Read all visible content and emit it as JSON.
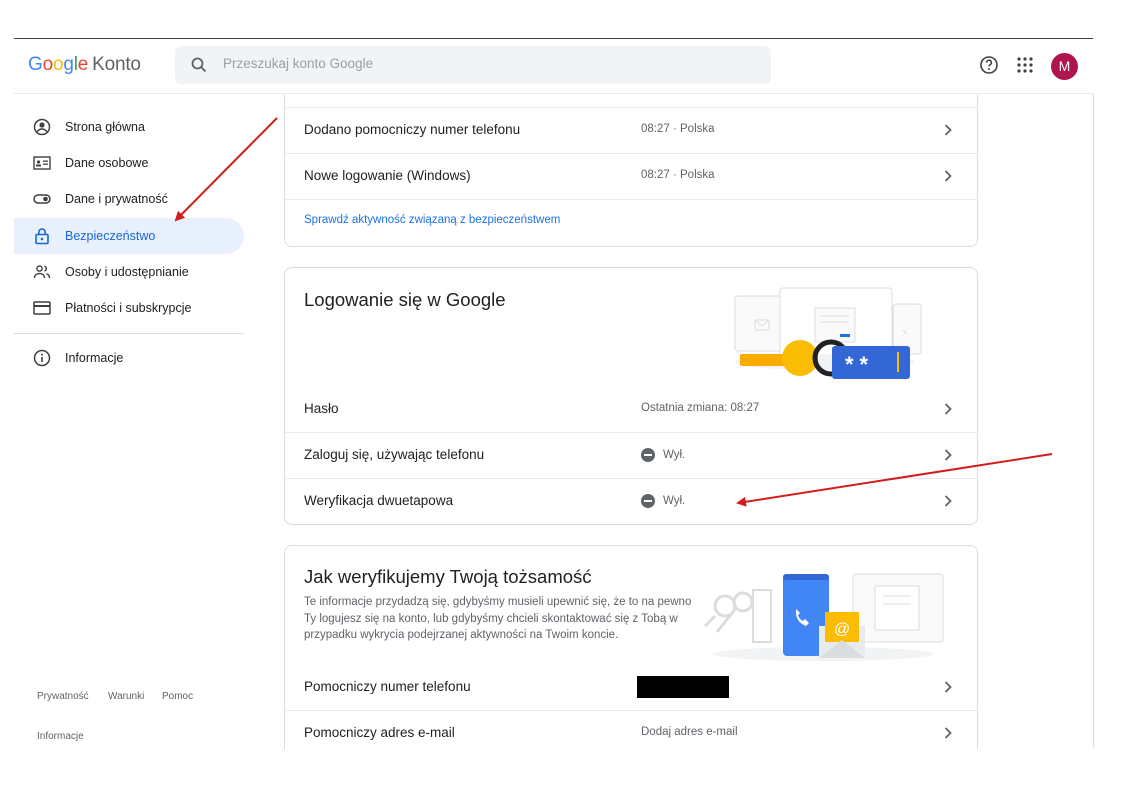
{
  "header": {
    "logo": {
      "g1": "G",
      "g2": "o",
      "g3": "o",
      "g4": "g",
      "g5": "l",
      "g6": "e",
      "product": "Konto"
    },
    "search_placeholder": "Przeszukaj konto Google",
    "avatar_letter": "M"
  },
  "sidebar": {
    "items": [
      {
        "label": "Strona główna",
        "icon": "account-circle-icon"
      },
      {
        "label": "Dane osobowe",
        "icon": "id-card-icon"
      },
      {
        "label": "Dane i prywatność",
        "icon": "toggle-icon"
      },
      {
        "label": "Bezpieczeństwo",
        "icon": "lock-icon",
        "active": true
      },
      {
        "label": "Osoby i udostępnianie",
        "icon": "people-icon"
      },
      {
        "label": "Płatności i subskrypcje",
        "icon": "credit-card-icon"
      },
      {
        "label": "Informacje",
        "icon": "info-icon"
      }
    ],
    "footer": {
      "privacy": "Prywatność",
      "terms": "Warunki",
      "help": "Pomoc",
      "about": "Informacje"
    }
  },
  "recent_activity": {
    "rows": [
      {
        "label": "Dodano pomocniczy numer telefonu",
        "value": "08:27 · Polska"
      },
      {
        "label": "Nowe logowanie (Windows)",
        "value": "08:27 · Polska"
      }
    ],
    "link": "Sprawdź aktywność związaną z bezpieczeństwem"
  },
  "signin": {
    "title": "Logowanie się w Google",
    "password_mask": "**",
    "rows": [
      {
        "label": "Hasło",
        "value": "Ostatnia zmiana: 08:27"
      },
      {
        "label": "Zaloguj się, używając telefonu",
        "value": "Wył."
      },
      {
        "label": "Weryfikacja dwuetapowa",
        "value": "Wył."
      }
    ]
  },
  "verify": {
    "title": "Jak weryfikujemy Twoją tożsamość",
    "desc": "Te informacje przydadzą się, gdybyśmy musieli upewnić się, że to na pewno Ty logujesz się na konto, lub gdybyśmy chcieli skontaktować się z Tobą w przypadku wykrycia podejrzanej aktywności na Twoim koncie.",
    "rows": [
      {
        "label": "Pomocniczy numer telefonu",
        "value": ""
      },
      {
        "label": "Pomocniczy adres e-mail",
        "value": "Dodaj adres e-mail"
      }
    ]
  },
  "colors": {
    "accent": "#1a73e8",
    "active_bg": "#e8f0fe",
    "avatar": "#b0144e",
    "annotation_arrow": "#d31c1c"
  }
}
